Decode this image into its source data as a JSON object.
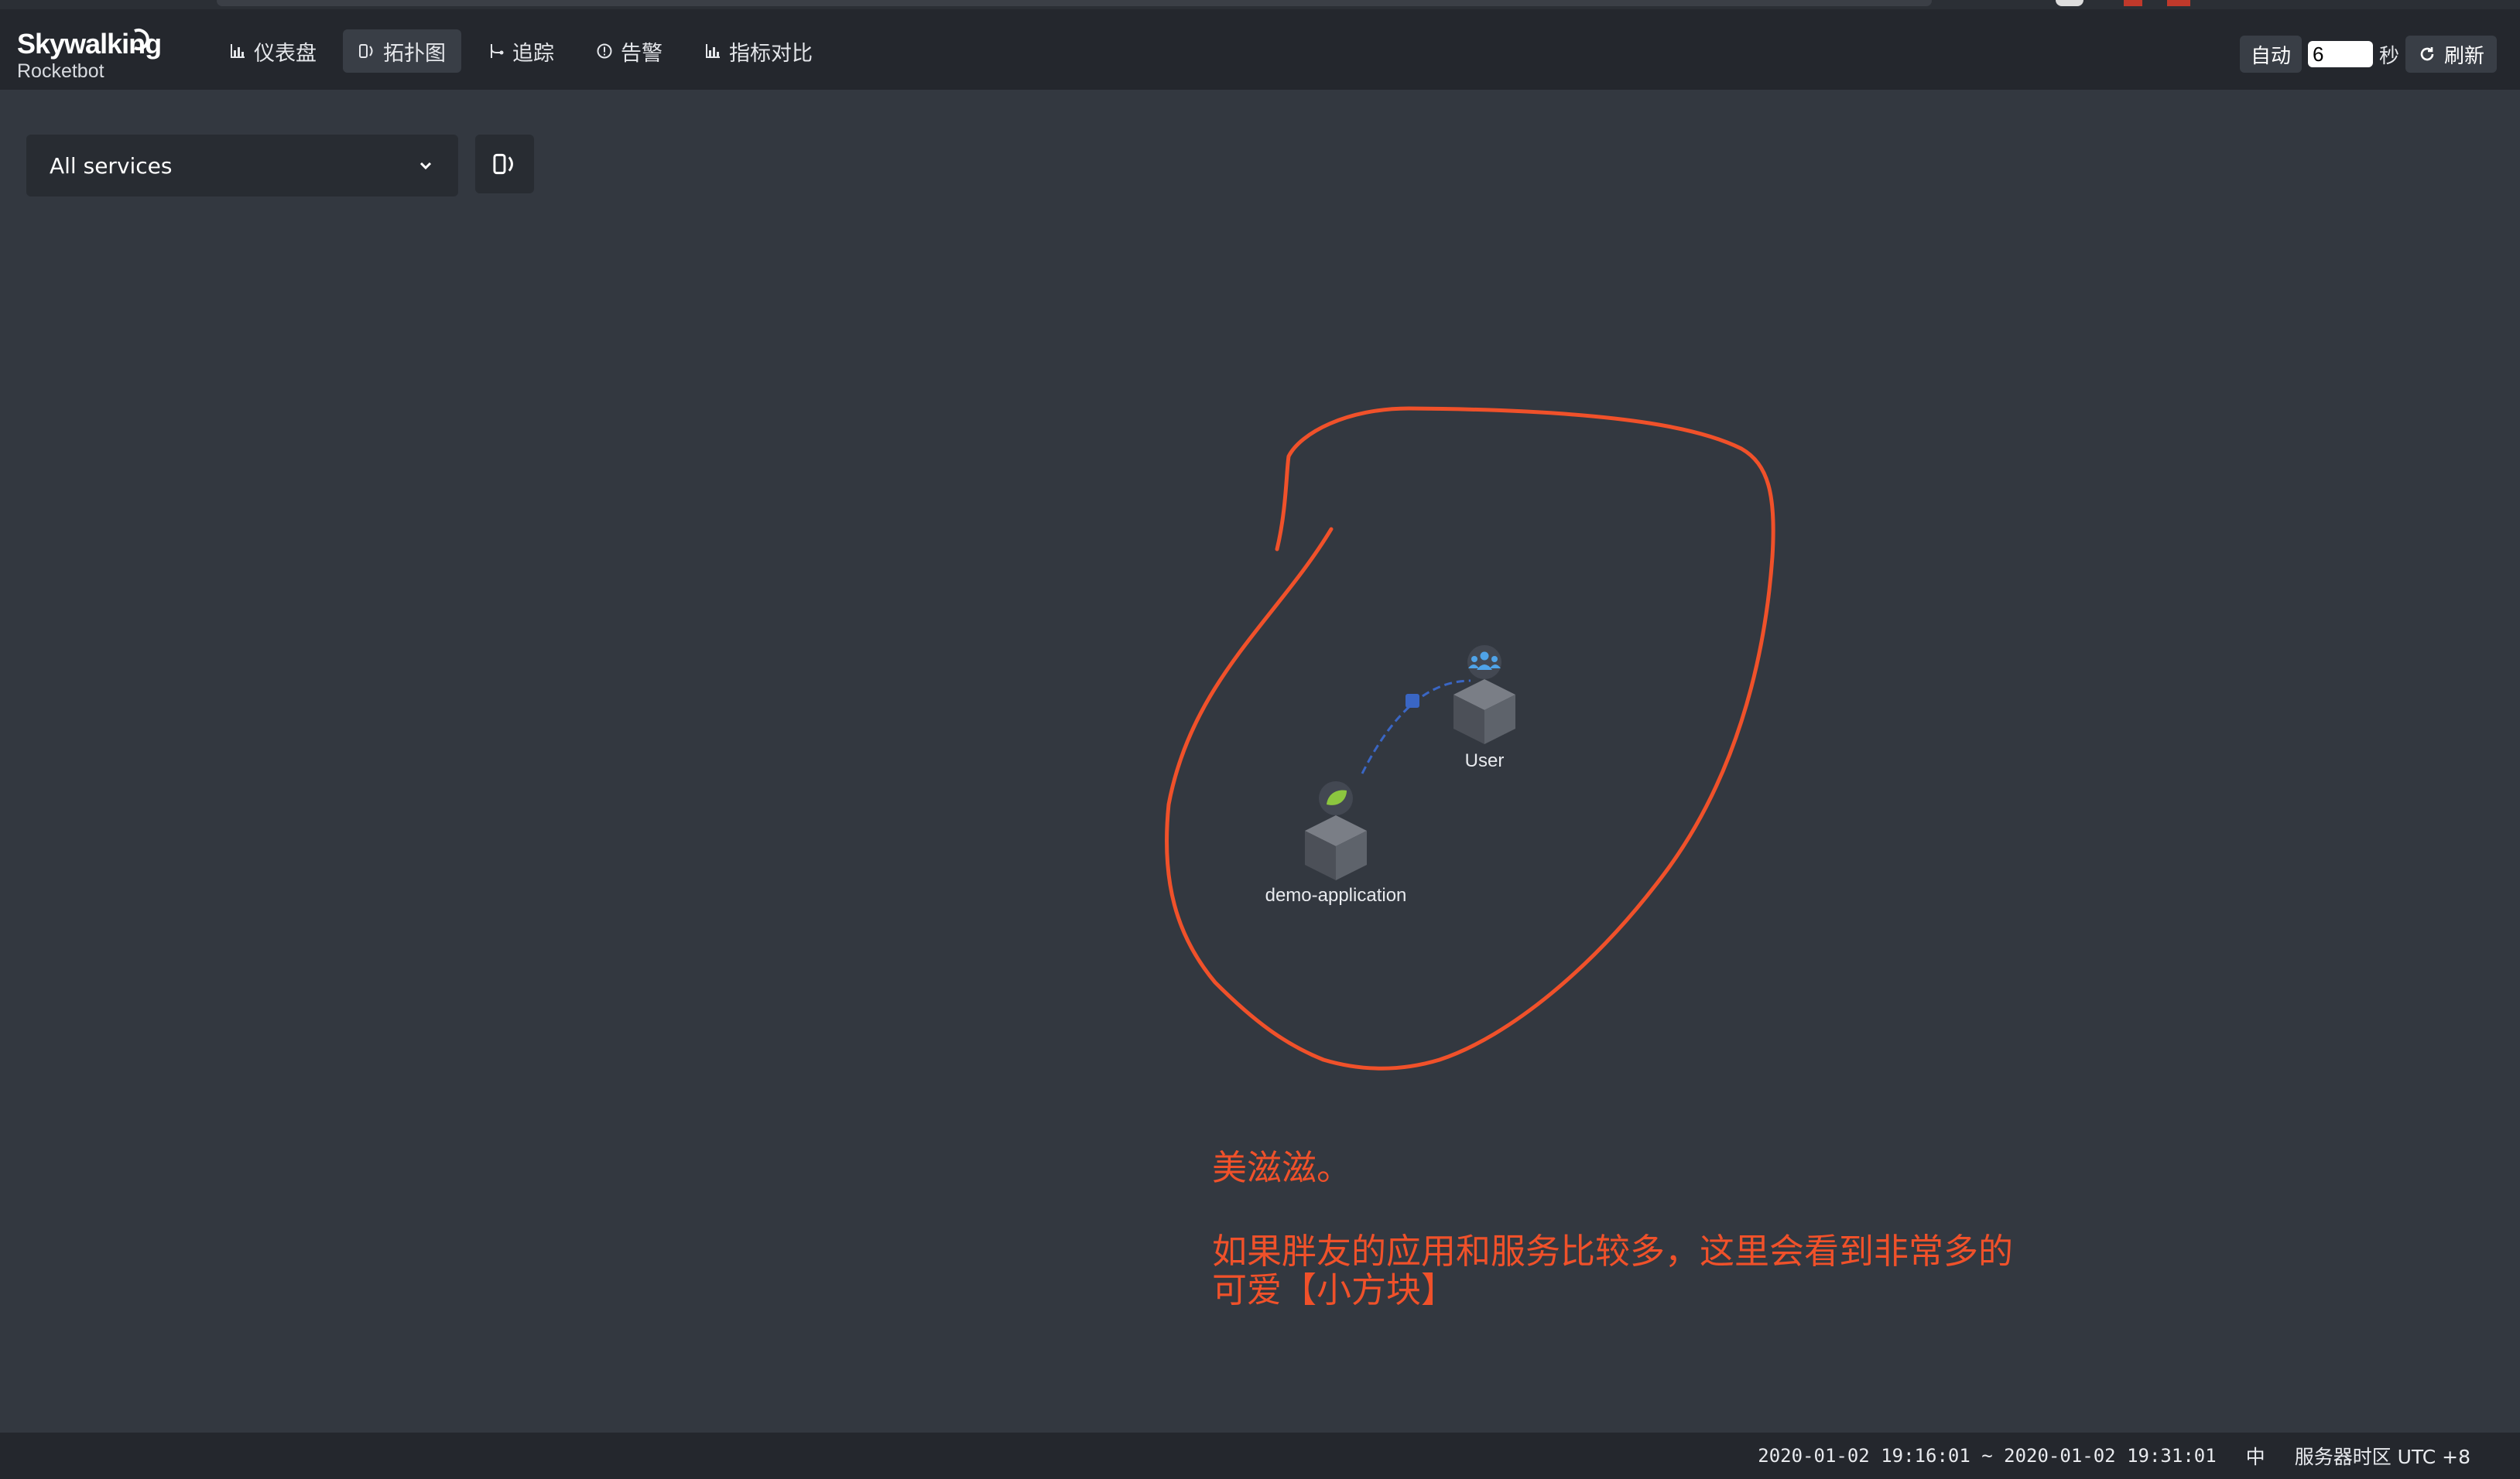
{
  "app": {
    "brand": "Skywalking",
    "subtitle": "Rocketbot"
  },
  "nav": {
    "items": [
      {
        "label": "仪表盘",
        "icon": "chart-icon"
      },
      {
        "label": "拓扑图",
        "icon": "topology-icon",
        "active": true
      },
      {
        "label": "追踪",
        "icon": "trace-icon"
      },
      {
        "label": "告警",
        "icon": "alarm-icon"
      },
      {
        "label": "指标对比",
        "icon": "chart-icon"
      }
    ]
  },
  "refresh": {
    "auto_label": "自动",
    "interval_value": "6",
    "seconds_label": "秒",
    "refresh_label": "刷新"
  },
  "toolbar": {
    "service_select_value": "All services"
  },
  "topology": {
    "nodes": [
      {
        "id": "user",
        "label": "User",
        "badge_icon": "users-icon"
      },
      {
        "id": "demo-application",
        "label": "demo-application",
        "badge_icon": "spring-leaf-icon"
      }
    ]
  },
  "annotation": {
    "line1": "美滋滋。",
    "line2": "如果胖友的应用和服务比较多，这里会看到非常多的",
    "line3": "可爱【小方块】",
    "color": "#f0512a"
  },
  "footer": {
    "time_range": "2020-01-02 19:16:01 ~ 2020-01-02 19:31:01",
    "language": "中",
    "timezone": "服务器时区 UTC +8"
  },
  "colors": {
    "background": "#333840",
    "header": "#24272d",
    "link": "#3a66c4",
    "user_badge": "#4fa3e8",
    "spring_badge": "#8cc63f"
  }
}
